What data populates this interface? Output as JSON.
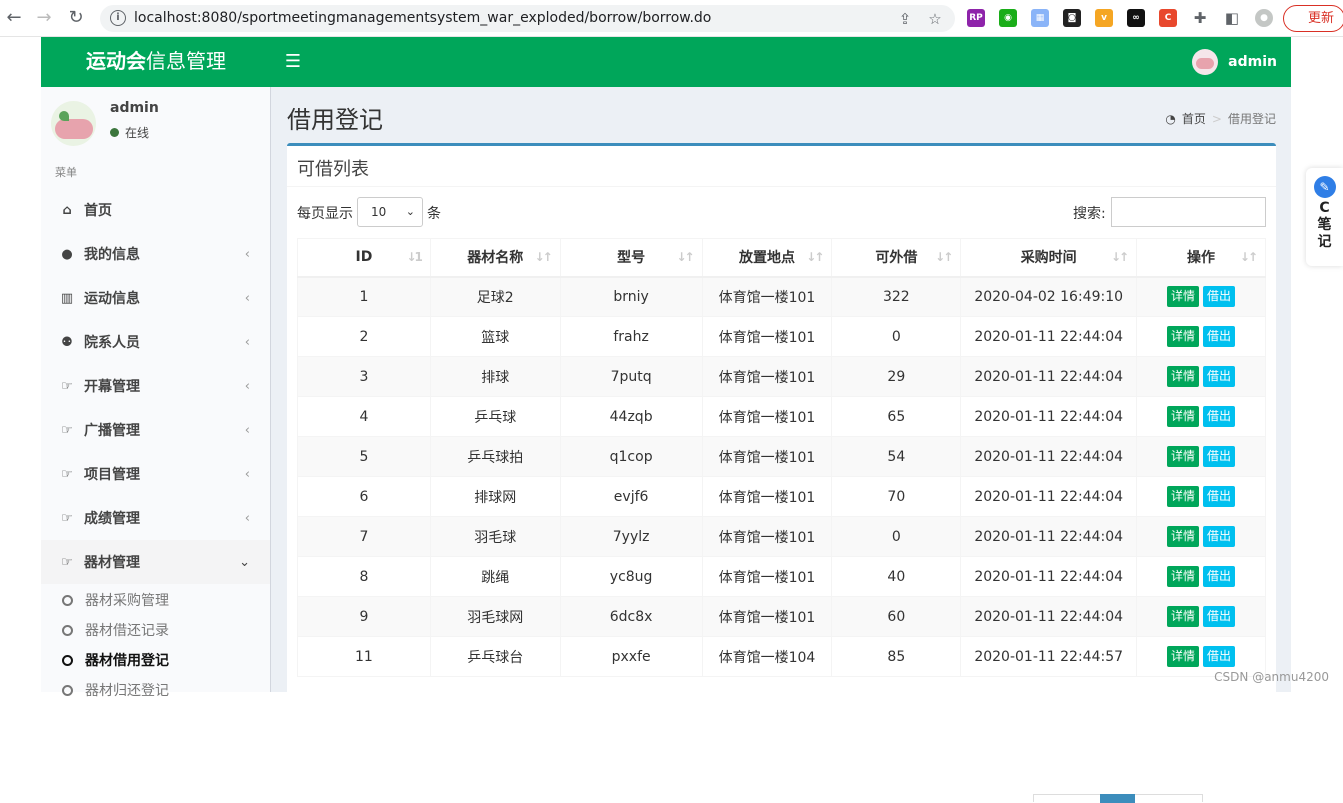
{
  "browser": {
    "url": "localhost:8080/sportmeetingmanagementsystem_war_exploded/borrow/borrow.do",
    "update_label": "更新"
  },
  "header": {
    "logo_bold": "运动会",
    "logo_rest": "信息管理",
    "user": "admin",
    "brand_color": "#00a65a"
  },
  "sidebar": {
    "user_name": "admin",
    "status": "在线",
    "menu_header": "菜单",
    "items": [
      {
        "label": "首页",
        "icon": "home-icon"
      },
      {
        "label": "我的信息",
        "icon": "user-icon"
      },
      {
        "label": "运动信息",
        "icon": "bar-chart-icon"
      },
      {
        "label": "院系人员",
        "icon": "users-icon"
      },
      {
        "label": "开幕管理",
        "icon": "hand-point-icon"
      },
      {
        "label": "广播管理",
        "icon": "hand-point-icon"
      },
      {
        "label": "项目管理",
        "icon": "hand-point-icon"
      },
      {
        "label": "成绩管理",
        "icon": "hand-point-icon"
      },
      {
        "label": "器材管理",
        "icon": "hand-point-icon"
      }
    ],
    "subitems": [
      {
        "label": "器材采购管理"
      },
      {
        "label": "器材借还记录"
      },
      {
        "label": "器材借用登记"
      },
      {
        "label": "器材归还登记"
      }
    ]
  },
  "content": {
    "title": "借用登记",
    "breadcrumb_home": "首页",
    "breadcrumb_current": "借用登记",
    "box_title": "可借列表",
    "length_prefix": "每页显示",
    "length_value": "10",
    "length_suffix": "条",
    "search_label": "搜索:"
  },
  "table": {
    "columns": [
      "ID",
      "器材名称",
      "型号",
      "放置地点",
      "可外借",
      "采购时间",
      "操作"
    ],
    "detail_label": "详情",
    "borrow_label": "借出",
    "rows": [
      [
        "1",
        "足球2",
        "brniy",
        "体育馆一楼101",
        "322",
        "2020-04-02 16:49:10"
      ],
      [
        "2",
        "篮球",
        "frahz",
        "体育馆一楼101",
        "0",
        "2020-01-11 22:44:04"
      ],
      [
        "3",
        "排球",
        "7putq",
        "体育馆一楼101",
        "29",
        "2020-01-11 22:44:04"
      ],
      [
        "4",
        "乒乓球",
        "44zqb",
        "体育馆一楼101",
        "65",
        "2020-01-11 22:44:04"
      ],
      [
        "5",
        "乒乓球拍",
        "q1cop",
        "体育馆一楼101",
        "54",
        "2020-01-11 22:44:04"
      ],
      [
        "6",
        "排球网",
        "evjf6",
        "体育馆一楼101",
        "70",
        "2020-01-11 22:44:04"
      ],
      [
        "7",
        "羽毛球",
        "7yylz",
        "体育馆一楼101",
        "0",
        "2020-01-11 22:44:04"
      ],
      [
        "8",
        "跳绳",
        "yc8ug",
        "体育馆一楼101",
        "40",
        "2020-01-11 22:44:04"
      ],
      [
        "9",
        "羽毛球网",
        "6dc8x",
        "体育馆一楼101",
        "60",
        "2020-01-11 22:44:04"
      ],
      [
        "11",
        "乒乓球台",
        "pxxfe",
        "体育馆一楼104",
        "85",
        "2020-01-11 22:44:57"
      ]
    ]
  },
  "widget": {
    "chars": [
      "C",
      "笔",
      "记"
    ]
  },
  "watermark": "CSDN @anmu4200"
}
